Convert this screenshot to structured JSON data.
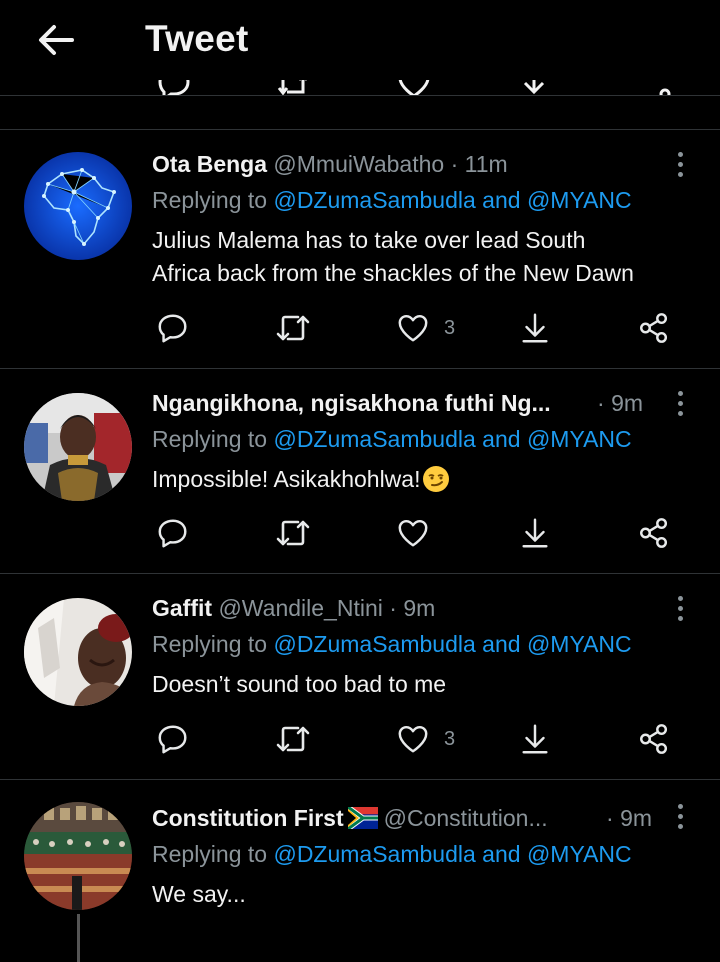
{
  "header": {
    "title": "Tweet",
    "back_icon": "arrow-left-icon"
  },
  "tweets": [
    {
      "name": "Ota Benga",
      "handle": "@MmuiWabatho",
      "time": "11m",
      "replying_prefix": "Replying to ",
      "replying_to": "@DZumaSambudla and @MYANC",
      "text_line1": "Julius  Malema has to take over lead South",
      "text_line2": "Africa back from the shackles of the New Dawn",
      "likes": "3"
    },
    {
      "name": "Ngangikhona, ngisakhona futhi Ng...",
      "handle": "",
      "time": "9m",
      "replying_prefix": "Replying to ",
      "replying_to": "@DZumaSambudla and @MYANC",
      "text_line1": "Impossible! Asikakhohlwa!",
      "likes": ""
    },
    {
      "name": "Gaffit",
      "handle": "@Wandile_Ntini",
      "time": "9m",
      "replying_prefix": "Replying to ",
      "replying_to": "@DZumaSambudla and @MYANC",
      "text_line1": "Doesn’t sound too bad to me",
      "likes": "3"
    },
    {
      "name": "Constitution First",
      "handle": "@Constitution...",
      "time": "9m",
      "replying_prefix": "Replying to ",
      "replying_to": "@DZumaSambudla and @MYANC",
      "text_line1": "We say..."
    }
  ],
  "separator": "·",
  "colors": {
    "background": "#000000",
    "link": "#1d9bf0",
    "muted": "#8b949a",
    "text": "#f2f2f2",
    "divider": "#2f3336"
  }
}
